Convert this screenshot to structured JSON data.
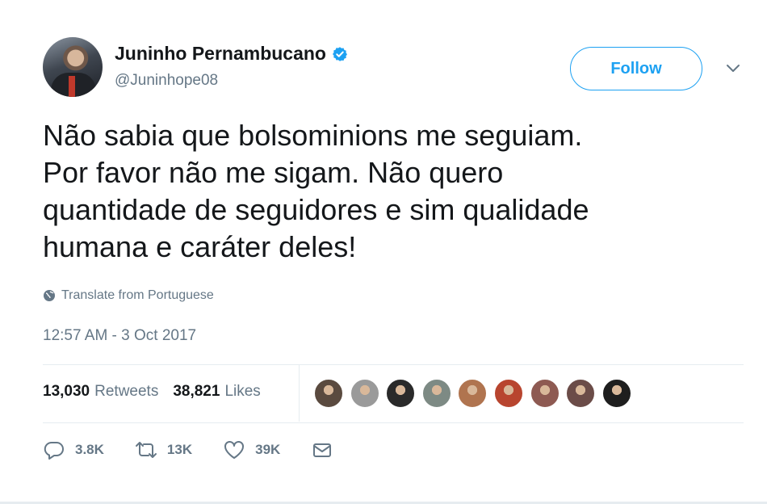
{
  "author": {
    "display_name": "Juninho Pernambucano",
    "handle": "@Juninhope08",
    "verified": true
  },
  "header": {
    "follow_label": "Follow"
  },
  "tweet": {
    "text": "Não sabia que bolsominions me seguiam.\nPor favor não me sigam. Não quero\nquantidade de seguidores e sim qualidade\nhumana e caráter deles!",
    "translate_label": "Translate from Portuguese",
    "timestamp": "12:57 AM - 3 Oct 2017"
  },
  "stats": {
    "retweets_count": "13,030",
    "retweets_label": "Retweets",
    "likes_count": "38,821",
    "likes_label": "Likes"
  },
  "likers": [
    {
      "color": "#5a4a3f"
    },
    {
      "color": "#9a9a9a"
    },
    {
      "color": "#2a2a2a"
    },
    {
      "color": "#7d8a84"
    },
    {
      "color": "#b0744f"
    },
    {
      "color": "#b8452f"
    },
    {
      "color": "#8e5a52"
    },
    {
      "color": "#6b4c48"
    },
    {
      "color": "#1e1e1e"
    }
  ],
  "actions": {
    "reply_count": "3.8K",
    "retweet_count": "13K",
    "like_count": "39K"
  },
  "colors": {
    "accent": "#1da1f2",
    "muted": "#657786",
    "text": "#14171a"
  },
  "icons": [
    "verified-badge-icon",
    "chevron-down-icon",
    "globe-icon",
    "reply-icon",
    "retweet-icon",
    "heart-icon",
    "envelope-icon"
  ]
}
